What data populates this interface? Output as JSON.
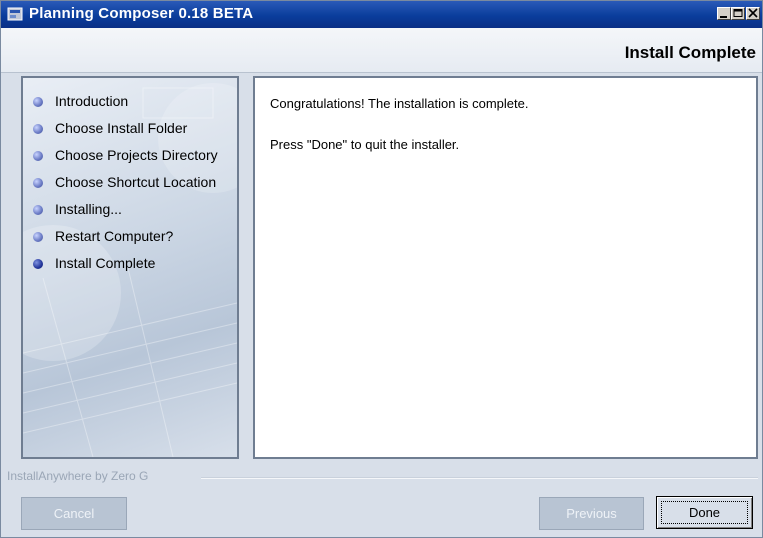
{
  "window": {
    "title": "Planning Composer 0.18 BETA",
    "icon": "installer-app-icon",
    "controls": [
      "minimize-icon",
      "maximize-icon",
      "close-icon"
    ]
  },
  "header": {
    "title": "Install Complete"
  },
  "steps": [
    {
      "label": "Introduction",
      "state": "done"
    },
    {
      "label": "Choose Install Folder",
      "state": "done"
    },
    {
      "label": "Choose Projects Directory",
      "state": "done"
    },
    {
      "label": "Choose Shortcut Location",
      "state": "done"
    },
    {
      "label": "Installing...",
      "state": "done"
    },
    {
      "label": "Restart Computer?",
      "state": "done"
    },
    {
      "label": "Install Complete",
      "state": "current"
    }
  ],
  "content": {
    "line1": "Congratulations! The installation is complete.",
    "line2": "Press \"Done\" to quit the installer."
  },
  "footer": {
    "vendor": "InstallAnywhere by Zero G",
    "cancel_label": "Cancel",
    "previous_label": "Previous",
    "done_label": "Done"
  },
  "colors": {
    "titlebar": "#0a3d9c",
    "panel_border": "#6f7d91",
    "disabled_button": "#b8c4d3"
  }
}
